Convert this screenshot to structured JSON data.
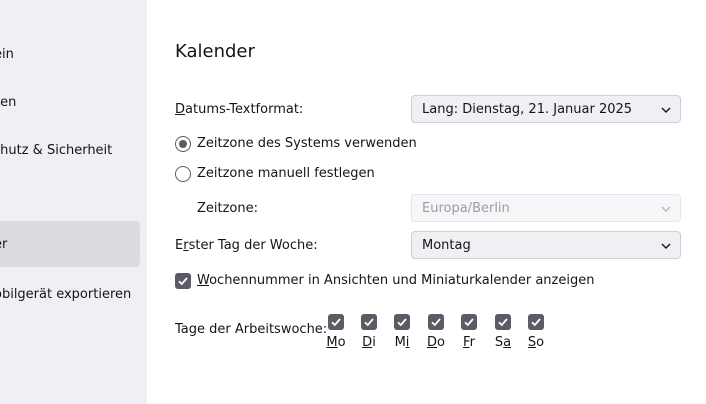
{
  "sidebar": {
    "items": [
      {
        "label": "ein",
        "selected": false
      },
      {
        "label": "ken",
        "selected": false
      },
      {
        "label": "chutz & Sicherheit",
        "selected": false
      },
      {
        "label": "er",
        "selected": true
      },
      {
        "label": "obilgerät exportieren",
        "selected": false
      }
    ]
  },
  "main": {
    "title": "Kalender",
    "date_format": {
      "label_accel": "D",
      "label_rest": "atums-Textformat:",
      "value": "Lang: Dienstag, 21. Januar 2025"
    },
    "timezone": {
      "radio_system_label": "Zeitzone des Systems verwenden",
      "radio_manual_label": "Zeitzone manuell festlegen",
      "selected": "system",
      "field_label": "Zeitzone:",
      "value": "Europa/Berlin"
    },
    "first_day": {
      "label_pre": "E",
      "label_accel": "r",
      "label_rest": "ster Tag der Woche:",
      "value": "Montag"
    },
    "week_number": {
      "accel": "W",
      "label_rest": "ochennummer in Ansichten und Miniaturkalender anzeigen",
      "checked": true
    },
    "workweek": {
      "label": "Tage der Arbeitswoche:",
      "days": [
        {
          "pre": "",
          "accel": "M",
          "post": "o",
          "checked": true
        },
        {
          "pre": "",
          "accel": "D",
          "post": "i",
          "checked": true
        },
        {
          "pre": "M",
          "accel": "i",
          "post": "",
          "checked": true
        },
        {
          "pre": "",
          "accel": "D",
          "post": "o",
          "checked": true
        },
        {
          "pre": "",
          "accel": "F",
          "post": "r",
          "checked": true
        },
        {
          "pre": "S",
          "accel": "a",
          "post": "",
          "checked": true
        },
        {
          "pre": "",
          "accel": "S",
          "post": "o",
          "checked": true
        }
      ]
    }
  },
  "colors": {
    "sidebar_bg": "#f0f0f4",
    "selected_bg": "#dcdce0",
    "control_accent": "#5b5b66",
    "text": "#15141a"
  }
}
